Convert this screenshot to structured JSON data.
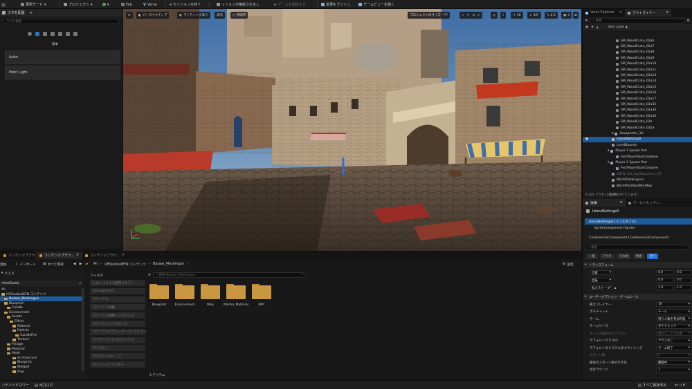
{
  "toolbar": {
    "mode_label": "選択モード",
    "project_label": "プロジェクト",
    "fab_label": "Fab",
    "verse_label": "Verse",
    "end_session_label": "セッションを終了",
    "session_status": "ッションが接続されまし",
    "start_game_label": "ゲームを開始する",
    "push_changes_label": "変更をプッシュ",
    "game_view_label": "ゲームビューを開く"
  },
  "place_actors": {
    "tab_title": "クタを配置",
    "search_placeholder": "ラスの検索",
    "category": "基本",
    "items": [
      "Actor",
      "Point Light"
    ]
  },
  "viewport": {
    "perspective_label": "パースペクティブ",
    "lighting_label": "ライティングあり",
    "show_label": "表示",
    "time_label": "時間帯",
    "project_size_label": "プロジェクトのサイズ: ???",
    "grid_snap": "10",
    "rot_snap": "10°",
    "scale_snap": "0.5",
    "camera_speed": "4"
  },
  "outliner": {
    "tab_verse": "Verse Explorer",
    "tab_outliner": "アウトライナー",
    "search_placeholder": "検索",
    "column_header": "Item Label ▲",
    "items": [
      {
        "label": "SM_WoodCrate_02a6",
        "indent": 48,
        "kind": "mesh"
      },
      {
        "label": "SM_WoodCrate_02a7",
        "indent": 48,
        "kind": "mesh"
      },
      {
        "label": "SM_WoodCrate_02a8",
        "indent": 48,
        "kind": "mesh"
      },
      {
        "label": "SM_WoodCrate_02a9",
        "indent": 48,
        "kind": "mesh"
      },
      {
        "label": "SM_WoodCrate_02a10",
        "indent": 48,
        "kind": "mesh"
      },
      {
        "label": "SM_WoodCrate_02a11",
        "indent": 48,
        "kind": "mesh"
      },
      {
        "label": "SM_WoodCrate_02a13",
        "indent": 48,
        "kind": "mesh"
      },
      {
        "label": "SM_WoodCrate_02a14",
        "indent": 48,
        "kind": "mesh"
      },
      {
        "label": "SM_WoodCrate_02a15",
        "indent": 48,
        "kind": "mesh"
      },
      {
        "label": "SM_WoodCrate_02a16",
        "indent": 48,
        "kind": "mesh"
      },
      {
        "label": "SM_WoodCrate_02a17",
        "indent": 48,
        "kind": "mesh"
      },
      {
        "label": "SM_WoodCrate_02a32",
        "indent": 48,
        "kind": "mesh"
      },
      {
        "label": "SM_WoodCrate_02a33",
        "indent": 48,
        "kind": "mesh"
      },
      {
        "label": "SM_WoodCrate_02a34",
        "indent": 48,
        "kind": "mesh"
      },
      {
        "label": "SM_WoodCrate_02b",
        "indent": 48,
        "kind": "mesh"
      },
      {
        "label": "SM_WoodCrate_02b3",
        "indent": 48,
        "kind": "mesh"
      },
      {
        "label": "GroupActor_10",
        "indent": 42,
        "kind": "group"
      },
      {
        "label": "IslandSettings0",
        "indent": 42,
        "kind": "settings",
        "selected": true
      },
      {
        "label": "LevelBounds",
        "indent": 42,
        "kind": "actor"
      },
      {
        "label": "Player 1 Spawn Pad",
        "indent": 36,
        "kind": "group"
      },
      {
        "label": "FortPlayerStartCreative",
        "indent": 48,
        "kind": "actor"
      },
      {
        "label": "Player 2 Spawn Pad",
        "indent": 36,
        "kind": "group"
      },
      {
        "label": "FortPlayerStartCreative",
        "indent": 48,
        "kind": "actor"
      },
      {
        "label": "UEFN_Chl_DaySequence_C0",
        "indent": 42,
        "kind": "actor",
        "dim": true
      },
      {
        "label": "WorldDataLayers",
        "indent": 42,
        "kind": "actor"
      },
      {
        "label": "WorldPartitionMiniMap",
        "indent": 42,
        "kind": "actor"
      }
    ],
    "status": "6,231 アクタ (1個選択されています)"
  },
  "details": {
    "tab_details": "詳細",
    "tab_world": "ワールドセッティ...",
    "object_name": "IslandSettings0",
    "instance_label": "IslandSettings0 (インスタンス)",
    "sprite_component": "SpriteComponent (Sprite)",
    "creative_link": "CreativeLinkComponent (CreativeLinkComponent)",
    "search_placeholder": "検索",
    "filter_tabs": [
      "一般",
      "アクタ",
      "その他",
      "物理",
      "全て"
    ],
    "transform_header": "トランスフォーム",
    "location_label": "位置",
    "rotation_label": "回転",
    "scale_label": "拡大スケール",
    "loc_values": [
      "0.0",
      "0.0"
    ],
    "rot_values": [
      "0.0",
      "0.0"
    ],
    "scale_values": [
      "1.0",
      "1.0"
    ],
    "user_options_header": "ユーザーオプション - ゲームルール",
    "rules": [
      {
        "label": "最大プレイヤー",
        "value": "16"
      },
      {
        "label": "ポチチャット",
        "value": "チーム"
      },
      {
        "label": "チーム",
        "value": "残り人数を参加可能"
      },
      {
        "label": "チームサイズ",
        "value": "ダイナミック"
      },
      {
        "label": "チームを最大のオプション",
        "value": "埋めることが必要",
        "dim": true
      },
      {
        "label": "デフォルトクラスID",
        "value": "クラスなし"
      },
      {
        "label": "デフォルトのクラスに戻すタイミング",
        "value": "ゲーム終了"
      },
      {
        "label": "スポーン数",
        "value": "0",
        "dim": true
      },
      {
        "label": "最後のスポーン後の行き先",
        "value": "観戦中"
      },
      {
        "label": "合計ラウンド",
        "value": "1"
      }
    ]
  },
  "content": {
    "tabs": [
      "コンテンツブラウ...",
      "コンテンツブラウ...",
      "コンテンツブラウ..."
    ],
    "add_label": "追加",
    "import_label": "インポート",
    "save_all_label": "すべて保存",
    "path": [
      "All",
      "UEStudioUEFN コンテンツ",
      "Bazaar_Meshingun"
    ],
    "settings_label": "設定",
    "favorites_label": "に入り",
    "project_label": "ritneGame",
    "tree": [
      {
        "label": "All",
        "indent": 2,
        "folder": false
      },
      {
        "label": "UEStudioUEFN コンテンツ",
        "indent": 2,
        "folder": true
      },
      {
        "label": "Bazaar_Meshingun",
        "indent": 6,
        "folder": true,
        "selected": true
      },
      {
        "label": "Blueprint",
        "indent": 6,
        "folder": true
      },
      {
        "label": "Candle",
        "indent": 10,
        "folder": true
      },
      {
        "label": "Environment",
        "indent": 6,
        "folder": true
      },
      {
        "label": "Assets",
        "indent": 10,
        "folder": true
      },
      {
        "label": "Effect",
        "indent": 14,
        "folder": true
      },
      {
        "label": "Material",
        "indent": 18,
        "folder": true
      },
      {
        "label": "Particle",
        "indent": 18,
        "folder": true
      },
      {
        "label": "CandleFire",
        "indent": 22,
        "folder": true
      },
      {
        "label": "Texture",
        "indent": 18,
        "folder": true
      },
      {
        "label": "Foliage",
        "indent": 10,
        "folder": true
      },
      {
        "label": "Material",
        "indent": 10,
        "folder": true
      },
      {
        "label": "Mesh",
        "indent": 10,
        "folder": true
      },
      {
        "label": "Architecture",
        "indent": 18,
        "folder": true
      },
      {
        "label": "Blueprint",
        "indent": 18,
        "folder": true
      },
      {
        "label": "Merged",
        "indent": 18,
        "folder": true
      },
      {
        "label": "Prop",
        "indent": 18,
        "folder": true
      }
    ],
    "filter_title": "フィルタ",
    "filters": [
      "どのレベルでも使用されてい",
      "Unsupported",
      "マテリアル",
      "マテリアル関数",
      "マテリアル関数インスタンス",
      "マテリアルインスタンス",
      "マテリアルパラメーターコレクション",
      "サブサーフェスプロファイル",
      "テクスチャ",
      "テクスチャキューブ",
      "ボリュームテクスチャ"
    ],
    "search_placeholder": "検索 Bazaar_Meshingun",
    "folders": [
      "Blueprint",
      "Environment",
      "Map",
      "Master_Material",
      "NPC"
    ],
    "item_count": "5 アイテム"
  },
  "status": {
    "drawer_label": "ンテンツドロワー",
    "output_log_label": "出力ログ",
    "save_all_label": "すべて保存済み",
    "revision_label": "リビ"
  },
  "colors": {
    "accent": "#1f5a9a",
    "folder": "#c9973f"
  }
}
